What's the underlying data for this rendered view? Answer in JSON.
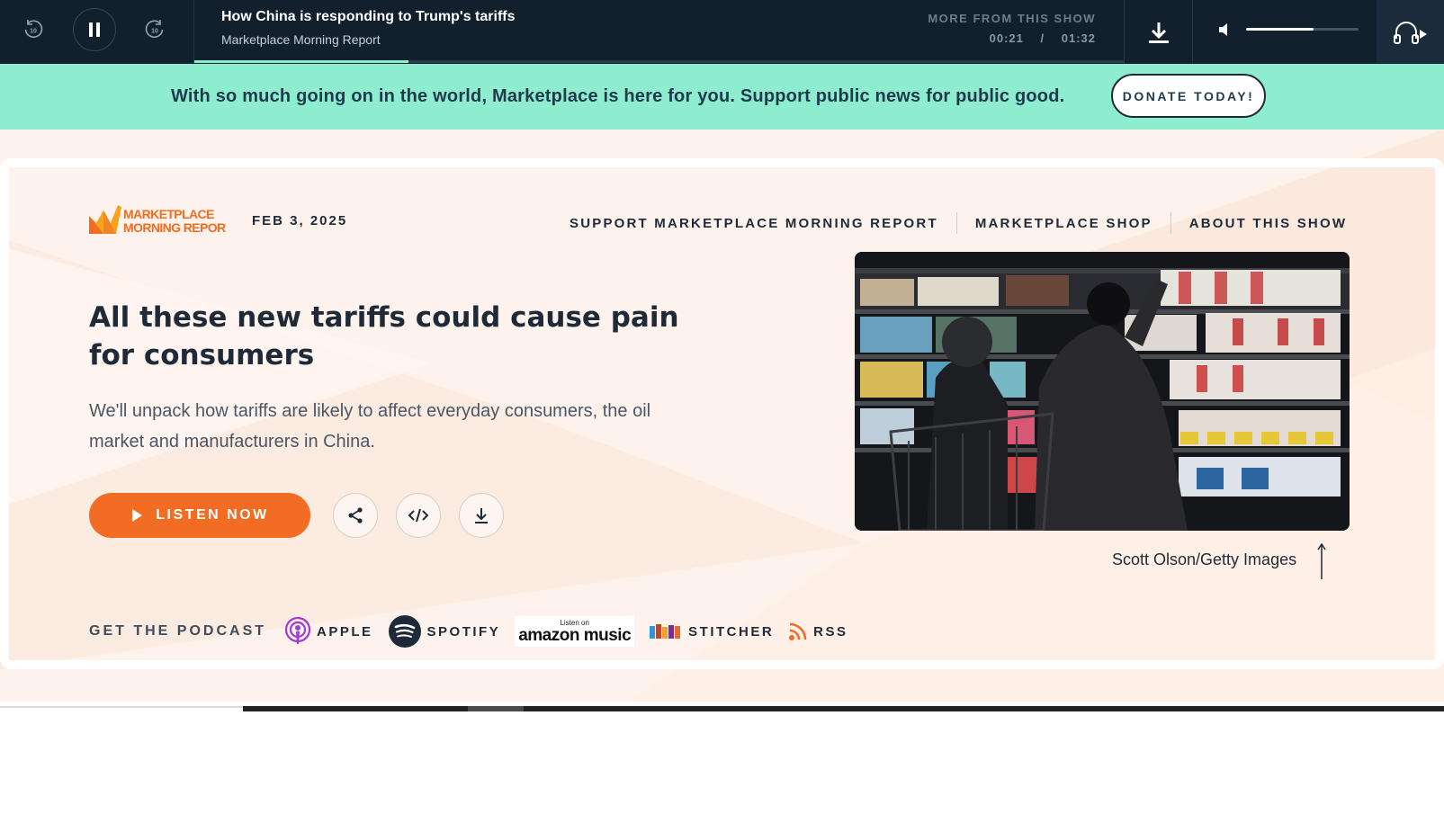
{
  "player": {
    "episode_title": "How China is responding to Trump's tariffs",
    "show_name": "Marketplace Morning Report",
    "more_from_show": "MORE FROM THIS SHOW",
    "elapsed": "00:21",
    "separator": "/",
    "duration": "01:32",
    "skip_back_label": "10",
    "skip_forward_label": "10",
    "progress_fraction": 0.23,
    "volume_fraction": 0.6
  },
  "banner": {
    "message": "With so much going on in the world, Marketplace is here for you. Support public news for public good.",
    "donate_label": "DONATE TODAY!"
  },
  "header": {
    "logo_line1": "MARKETPLACE",
    "logo_line2": "MORNING REPORT",
    "date": "FEB 3, 2025",
    "nav": [
      {
        "label": "SUPPORT MARKETPLACE MORNING REPORT"
      },
      {
        "label": "MARKETPLACE SHOP"
      },
      {
        "label": "ABOUT THIS SHOW"
      }
    ]
  },
  "article": {
    "headline": "All these new tariffs could cause pain for consumers",
    "summary": "We'll unpack how tariffs are likely to affect everyday consumers, the oil market and manufacturers in China.",
    "listen_label": "LISTEN NOW",
    "photo_credit": "Scott Olson/Getty Images"
  },
  "podcast": {
    "label": "GET THE PODCAST",
    "platforms": [
      {
        "name": "APPLE",
        "icon": "apple-podcasts-icon"
      },
      {
        "name": "SPOTIFY",
        "icon": "spotify-icon"
      },
      {
        "name": "amazon music",
        "small": "Listen on",
        "icon": "amazon-music-icon"
      },
      {
        "name": "STITCHER",
        "icon": "stitcher-icon"
      },
      {
        "name": "RSS",
        "icon": "rss-icon"
      }
    ]
  },
  "colors": {
    "player_bg": "#121f2d",
    "banner_bg": "#8eedcf",
    "accent_orange": "#f26c23",
    "hero_bg": "#fdf2ec",
    "text_dark": "#1f2a38"
  }
}
